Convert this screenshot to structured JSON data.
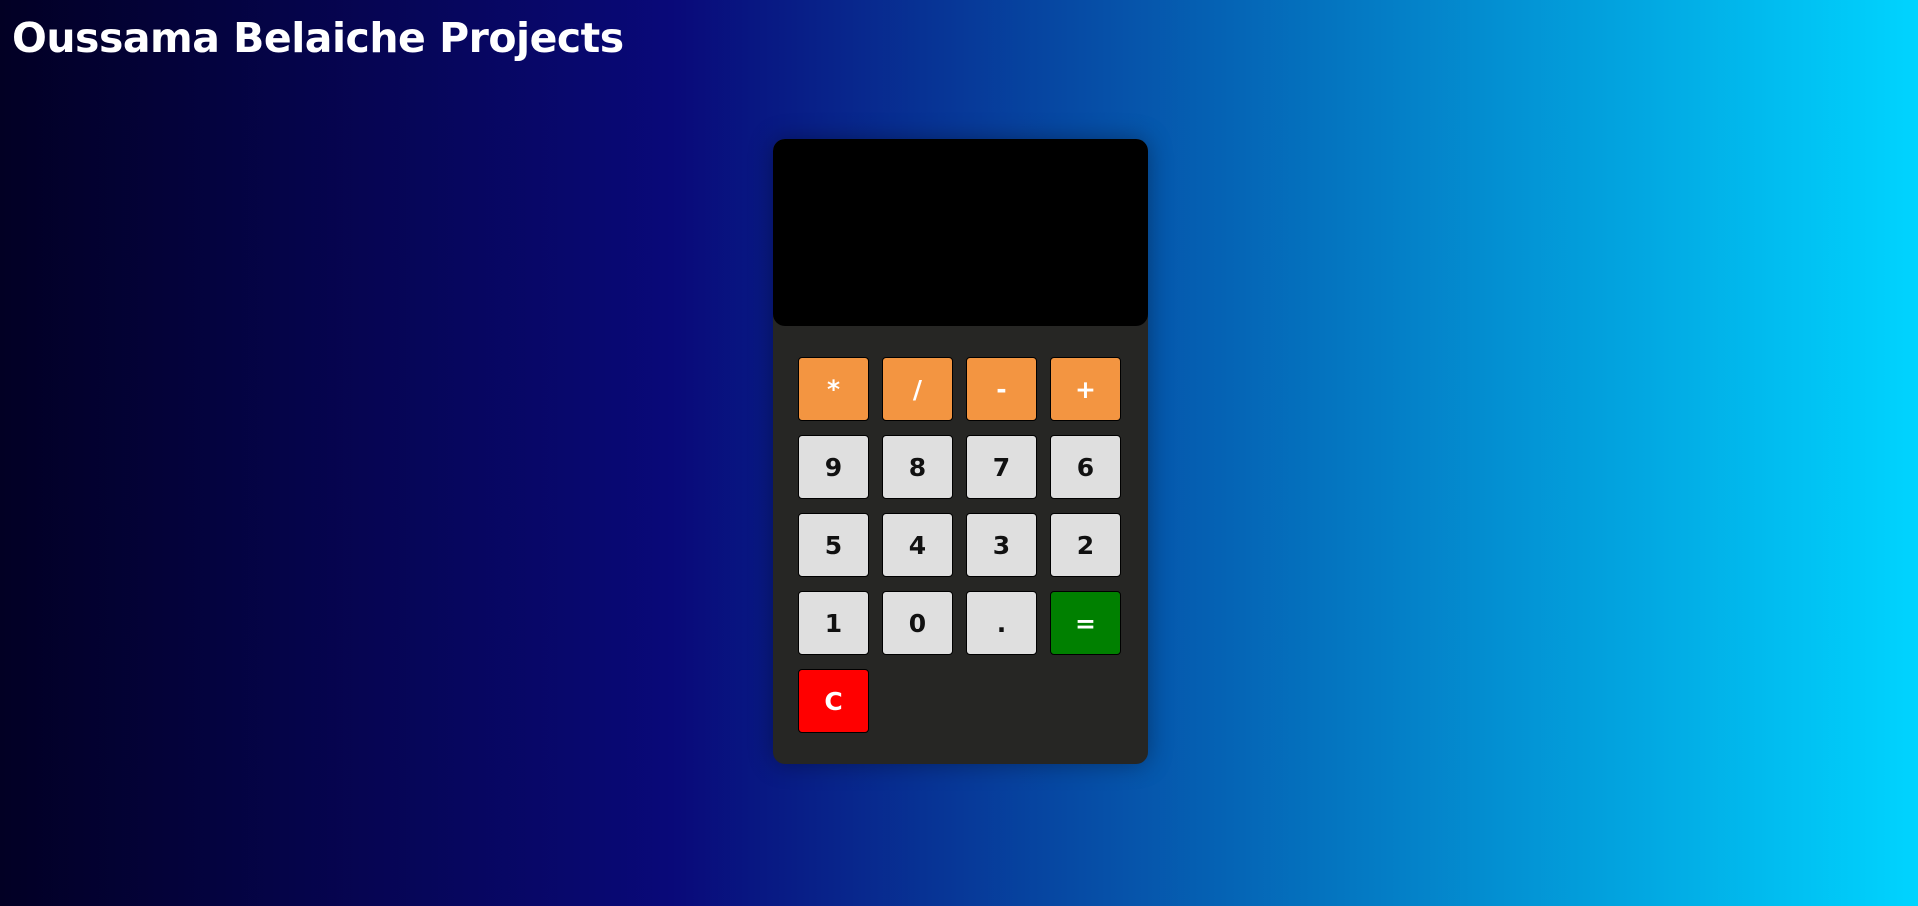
{
  "site": {
    "title": "Oussama Belaiche Projects"
  },
  "calculator": {
    "display_value": "",
    "keys": {
      "multiply": "*",
      "divide": "/",
      "subtract": "-",
      "add": "+",
      "nine": "9",
      "eight": "8",
      "seven": "7",
      "six": "6",
      "five": "5",
      "four": "4",
      "three": "3",
      "two": "2",
      "one": "1",
      "zero": "0",
      "decimal": ".",
      "equals": "=",
      "clear": "C"
    }
  },
  "colors": {
    "background_gradient": [
      "#020024",
      "#090979",
      "#00d4ff"
    ],
    "calculator_body": "#262624",
    "display": "#000000",
    "operator_key": "#f39541",
    "number_key": "#dfdfdf",
    "equals_key": "#008000",
    "clear_key": "#ff0000"
  }
}
